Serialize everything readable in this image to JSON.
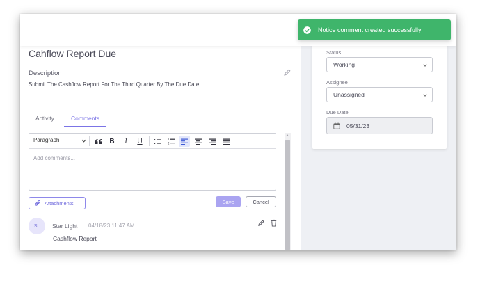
{
  "task": {
    "title": "Cahflow Report Due",
    "description_label": "Description",
    "description": "Submit The Cashflow Report For The Third Quarter By The Due Date."
  },
  "tabs": [
    {
      "label": "Activity",
      "active": false
    },
    {
      "label": "Comments",
      "active": true
    }
  ],
  "editor": {
    "paragraph_style": "Paragraph",
    "toolbar_icons": [
      "blockquote-icon",
      "bold-icon",
      "italic-icon",
      "underline-icon",
      "bulleted-list-icon",
      "numbered-list-icon",
      "align-left-icon",
      "align-center-icon",
      "align-right-icon",
      "align-justify-icon"
    ],
    "placeholder": "Add comments..."
  },
  "actions": {
    "attachments_label": "Attachments",
    "save_label": "Save",
    "cancel_label": "Cancel"
  },
  "comments": [
    {
      "initials": "SL",
      "author": "Star Light",
      "timestamp": "04/18/23 11:47 AM",
      "text": "Cashflow Report"
    }
  ],
  "details": {
    "status_label": "Status",
    "status_value": "Working",
    "assignee_label": "Assignee",
    "assignee_value": "Unassigned",
    "due_date_label": "Due Date",
    "due_date_value": "05/31/23"
  },
  "toast": {
    "message": "Notice comment created successfully"
  },
  "colors": {
    "accent": "#7b74e6",
    "save_button": "#aaa4f1",
    "toast_success": "#3fb56b",
    "page_background": "#eef0f4"
  }
}
